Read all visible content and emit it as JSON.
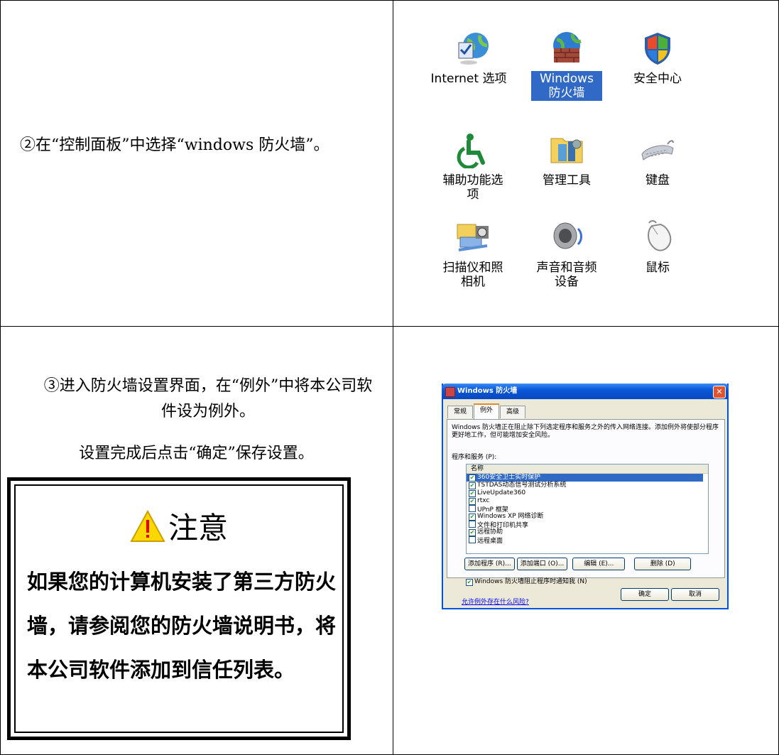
{
  "step2": {
    "num": "②",
    "text": "在“控制面板”中选择“windows 防火墙”。"
  },
  "control_panel": [
    {
      "icon": "internet-options-icon",
      "label": "Internet 选项"
    },
    {
      "icon": "windows-firewall-icon",
      "label": "Windows 防火墙",
      "selected": true
    },
    {
      "icon": "security-center-icon",
      "label": "安全中心"
    },
    {
      "icon": "accessibility-icon",
      "label": "辅助功能选项"
    },
    {
      "icon": "admin-tools-icon",
      "label": "管理工具"
    },
    {
      "icon": "keyboard-icon",
      "label": "键盘"
    },
    {
      "icon": "scanner-camera-icon",
      "label": "扫描仪和照相机"
    },
    {
      "icon": "sound-icon",
      "label": "声音和音频设备"
    },
    {
      "icon": "mouse-icon",
      "label": "鼠标"
    }
  ],
  "step3": {
    "num": "③",
    "text": "进入防火墙设置界面，在“例外”中将本公司软件设为例外。",
    "sub": "设置完成后点击“确定”保存设置。"
  },
  "notice": {
    "title": "注意",
    "body": "如果您的计算机安装了第三方防火墙，请参阅您的防火墙说明书，将本公司软件添加到信任列表。"
  },
  "dialog": {
    "title": "Windows 防火墙",
    "tabs": [
      "常规",
      "例外",
      "高级"
    ],
    "active_tab": 1,
    "description": "Windows 防火墙正在阻止除下列选定程序和服务之外的传入网络连接。添加例外将使部分程序更好地工作，但可能增加安全风险。",
    "programs_label": "程序和服务 (P):",
    "column_name": "名称",
    "programs": [
      {
        "name": "360安全卫士实时保护",
        "checked": true,
        "selected": true
      },
      {
        "name": "TSTDAS动态信号测试分析系统",
        "checked": true
      },
      {
        "name": "LiveUpdate360",
        "checked": true
      },
      {
        "name": "rtxc",
        "checked": true
      },
      {
        "name": "UPnP 框架",
        "checked": false
      },
      {
        "name": "Windows XP 网络诊断",
        "checked": true
      },
      {
        "name": "文件和打印机共享",
        "checked": false
      },
      {
        "name": "远程协助",
        "checked": true
      },
      {
        "name": "远程桌面",
        "checked": false
      }
    ],
    "buttons": [
      "添加程序 (R)...",
      "添加端口 (O)...",
      "编辑 (E)...",
      "删除 (D)"
    ],
    "notify_label": "Windows 防火墙阻止程序时通知我 (N)",
    "risk_link": "允许例外存在什么风险?",
    "ok": "确定",
    "cancel": "取消"
  }
}
